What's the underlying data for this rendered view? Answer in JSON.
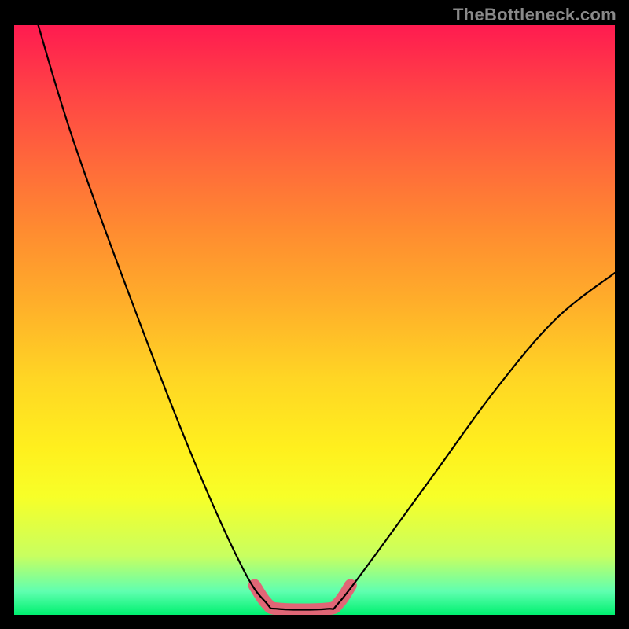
{
  "attribution": "TheBottleneck.com",
  "chart_data": {
    "type": "line",
    "title": "",
    "xlabel": "",
    "ylabel": "",
    "xlim": [
      0,
      100
    ],
    "ylim": [
      0,
      100
    ],
    "series": [
      {
        "name": "bottleneck-curve",
        "points": [
          {
            "x": 4,
            "y": 100
          },
          {
            "x": 10,
            "y": 80
          },
          {
            "x": 20,
            "y": 52
          },
          {
            "x": 30,
            "y": 26
          },
          {
            "x": 38,
            "y": 8
          },
          {
            "x": 42,
            "y": 2
          },
          {
            "x": 44,
            "y": 1
          },
          {
            "x": 52,
            "y": 1
          },
          {
            "x": 54,
            "y": 2
          },
          {
            "x": 60,
            "y": 10
          },
          {
            "x": 70,
            "y": 24
          },
          {
            "x": 80,
            "y": 38
          },
          {
            "x": 90,
            "y": 50
          },
          {
            "x": 100,
            "y": 58
          }
        ]
      },
      {
        "name": "optimal-zone-marker",
        "points": [
          {
            "x": 40,
            "y": 5
          },
          {
            "x": 42,
            "y": 2
          },
          {
            "x": 44,
            "y": 1
          },
          {
            "x": 52,
            "y": 1
          },
          {
            "x": 54,
            "y": 2
          },
          {
            "x": 56,
            "y": 5
          }
        ],
        "color": "#e06676",
        "stroke_width": 16
      }
    ],
    "gradient_stops": [
      {
        "pos": 0.0,
        "color": "#ff1b50"
      },
      {
        "pos": 0.5,
        "color": "#ffd000"
      },
      {
        "pos": 0.82,
        "color": "#f7ff28"
      },
      {
        "pos": 1.0,
        "color": "#00f070"
      }
    ]
  }
}
